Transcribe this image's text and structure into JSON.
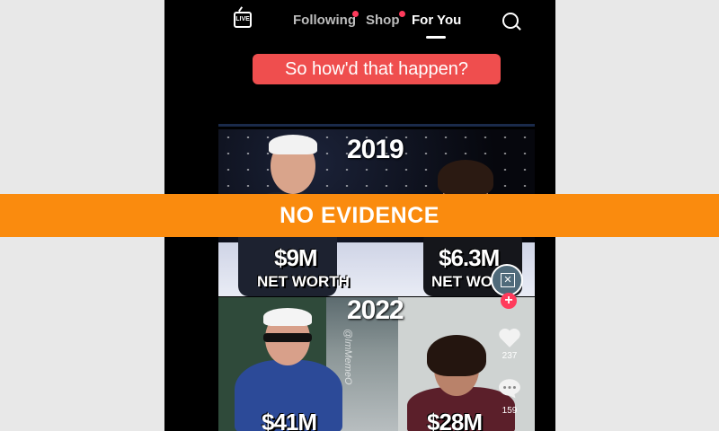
{
  "nav": {
    "live_label": "LIVE",
    "tabs": [
      {
        "label": "Following",
        "has_dot": true
      },
      {
        "label": "Shop",
        "has_dot": true
      },
      {
        "label": "For You",
        "active": true
      }
    ],
    "search_icon": "search-icon"
  },
  "video": {
    "caption": "So how'd that happen?",
    "panel_2019": {
      "year": "2019",
      "left_amount": "$9M",
      "left_label": "NET WORTH",
      "right_amount": "$6.3M",
      "right_label": "NET WOR"
    },
    "panel_2022": {
      "year": "2022",
      "left_amount": "$41M",
      "right_amount": "$28M",
      "watermark": "@ImMemeO"
    }
  },
  "actions": {
    "avatar_icon": "avatar",
    "follow_icon": "plus-icon",
    "like_count": "237",
    "comment_count": "159"
  },
  "banner": {
    "text": "NO EVIDENCE",
    "color": "#fa8b0e"
  }
}
